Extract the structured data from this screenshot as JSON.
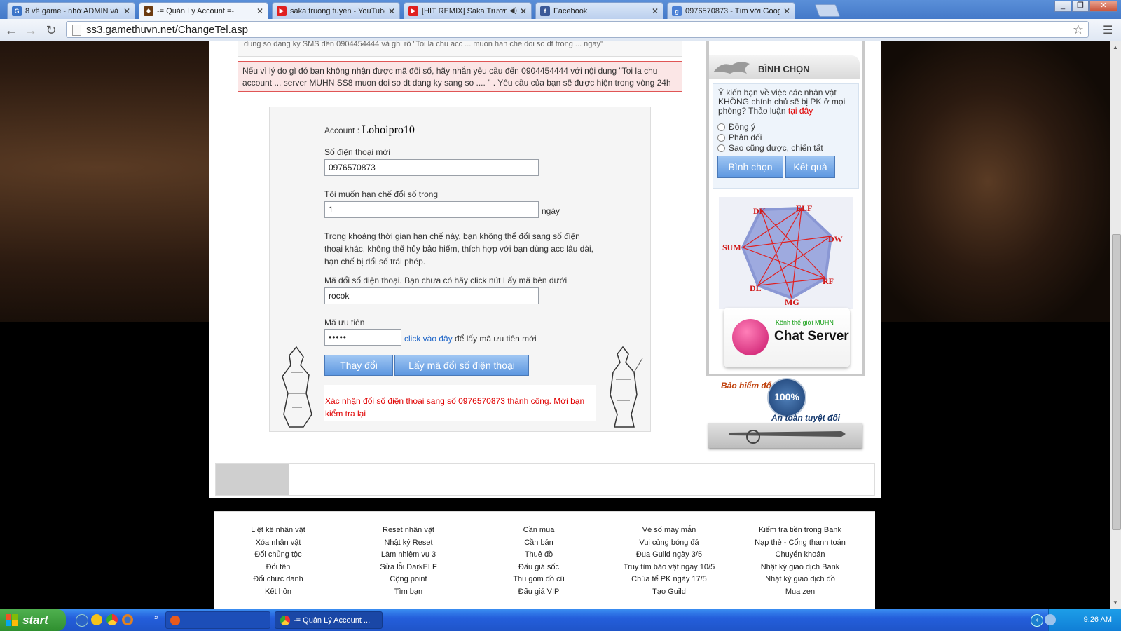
{
  "browser": {
    "tabs": [
      {
        "title": "8 về game - nhờ ADMIN và c",
        "favicon": "G"
      },
      {
        "title": "-= Quản Lý Account =-",
        "favicon": "game"
      },
      {
        "title": "saka truong tuyen - YouTube",
        "favicon": "yt"
      },
      {
        "title": "[HIT REMIX] Saka Trương",
        "favicon": "yt"
      },
      {
        "title": "Facebook",
        "favicon": "f"
      },
      {
        "title": "0976570873 - Tìm với Google",
        "favicon": "g"
      }
    ],
    "url": "ss3.gamethuvn.net/ChangeTel.asp"
  },
  "notices": {
    "top_partial": "dung so dang ky SMS đến 0904454444 và ghi rõ \"Toi la chu acc ... muon han che doi so dt trong ... ngay\"",
    "red_notice": "Nếu vì lý do gì đó bạn không nhận được mã đổi số, hãy nhắn yêu cầu đến 0904454444 với nội dung \"Toi la chu account ... server MUHN SS8 muon doi so dt dang ky sang so .... \" . Yêu cầu của bạn sẽ được hiện trong vòng 24h"
  },
  "form": {
    "account_label": "Account :",
    "account_value": "Lohoipro10",
    "new_phone_label": "Số điện thoại mới",
    "new_phone_value": "0976570873",
    "limit_label": "Tôi muốn hạn chế đổi số trong",
    "limit_value": "1",
    "limit_unit": "ngày",
    "limit_desc": "Trong khoảng thời gian hạn chế này, bạn không thể đổi sang số điện thoại khác, không thể hủy bảo hiểm, thích hợp với bạn dùng acc lâu dài, hạn chế bị đổi số trái phép.",
    "code_label": "Mã đổi số điện thoại. Bạn chưa có hãy click nút Lấy mã bên dưới",
    "code_value": "rocok",
    "priority_label": "Mã ưu tiên",
    "priority_value": "•••••",
    "priority_link": "click vào đây",
    "priority_suffix": "để lấy mã ưu tiên mới",
    "btn_change": "Thay đổi",
    "btn_get_code": "Lấy mã đổi số điện thoại",
    "success_msg": "Xác nhận đổi số điện thoại sang số 0976570873 thành công. Mời bạn kiểm tra lại"
  },
  "vote": {
    "title": "BÌNH CHỌN",
    "question": "Ý kiến bạn về việc các nhân vật KHÔNG chính chủ sẽ bị PK ở mọi phòng? Thảo luận",
    "question_link": "tại đây",
    "options": [
      "Đồng ý",
      "Phản đối",
      "Sao cũng được, chiến tất"
    ],
    "btn_vote": "Bình chọn",
    "btn_result": "Kết quả"
  },
  "classes": [
    "DK",
    "ELF",
    "DW",
    "RF",
    "MG",
    "DL",
    "SUM"
  ],
  "chat": {
    "small": "Kênh thế giới MUHN",
    "big": "Chat Server"
  },
  "insurance": {
    "top": "Bảo hiểm đổ",
    "pct": "100%",
    "bottom": "An toàn tuyệt đối"
  },
  "footer_cols": [
    [
      "Liệt kê nhân vật",
      "Xóa nhân vật",
      "Đổi chủng tộc",
      "Đổi tên",
      "Đổi chức danh",
      "Kết hôn"
    ],
    [
      "Reset nhân vật",
      "Nhật ký Reset",
      "Làm nhiệm vụ 3",
      "Sửa lỗi DarkELF",
      "Cộng point",
      "Tìm bạn"
    ],
    [
      "Cần mua",
      "Cần bán",
      "Thuê đồ",
      "Đấu giá sốc",
      "Thu gom đồ cũ",
      "Đấu giá VIP"
    ],
    [
      "Vé số may mắn",
      "Vui cùng bóng đá",
      "Đua Guild ngày 3/5",
      "Truy tìm bảo vật ngày 10/5",
      "Chúa tể PK ngày 17/5",
      "Tạo Guild"
    ],
    [
      "Kiểm tra tiền trong Bank",
      "Nạp thẻ - Cổng thanh toán",
      "Chuyển khoản",
      "Nhật ký giao dịch Bank",
      "Nhật ký giao dịch đồ",
      "Mua zen"
    ]
  ],
  "taskbar": {
    "start": "start",
    "active_window": "-= Quản Lý Account ...",
    "clock": "9:26 AM"
  }
}
